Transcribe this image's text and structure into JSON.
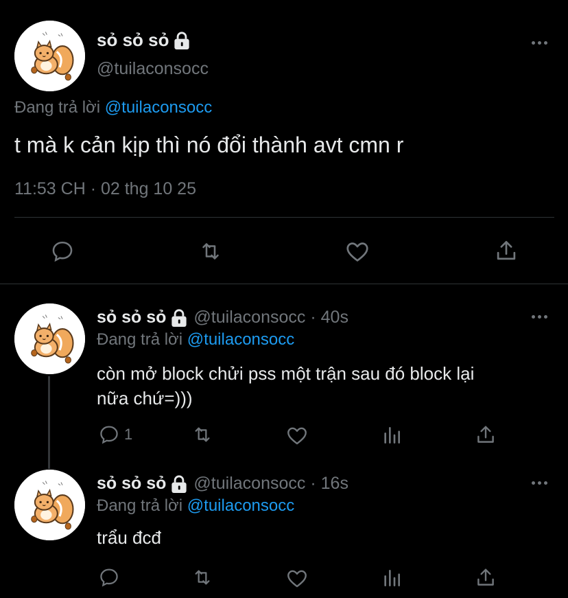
{
  "main_tweet": {
    "display_name": "sỏ sỏ sỏ",
    "handle": "@tuilaconsocc",
    "reply_prefix": "Đang trả lời",
    "reply_to": "@tuilaconsocc",
    "text": "t mà k cản kịp thì nó đổi thành avt cmn r",
    "timestamp": "11:53 CH · 02 thg 10 25",
    "actions": [
      "reply-icon",
      "retweet-icon",
      "like-icon",
      "share-icon"
    ]
  },
  "replies": [
    {
      "display_name": "sỏ sỏ sỏ",
      "handle": "@tuilaconsocc",
      "age": "· 40s",
      "reply_prefix": "Đang trả lời",
      "reply_to": "@tuilaconsocc",
      "text_line1": "còn mở block chửi pss một trận sau đó block lại",
      "text_line2": "nữa chứ=)))",
      "reply_count": "1"
    },
    {
      "display_name": "sỏ sỏ sỏ",
      "handle": "@tuilaconsocc",
      "age": "· 16s",
      "reply_prefix": "Đang trả lời",
      "reply_to": "@tuilaconsocc",
      "text": "trẩu đcđ",
      "reply_count": ""
    }
  ],
  "colors": {
    "background": "#000000",
    "text": "#e7e9ea",
    "muted": "#71767b",
    "link": "#1d9bf0",
    "divider": "#2f3336"
  }
}
